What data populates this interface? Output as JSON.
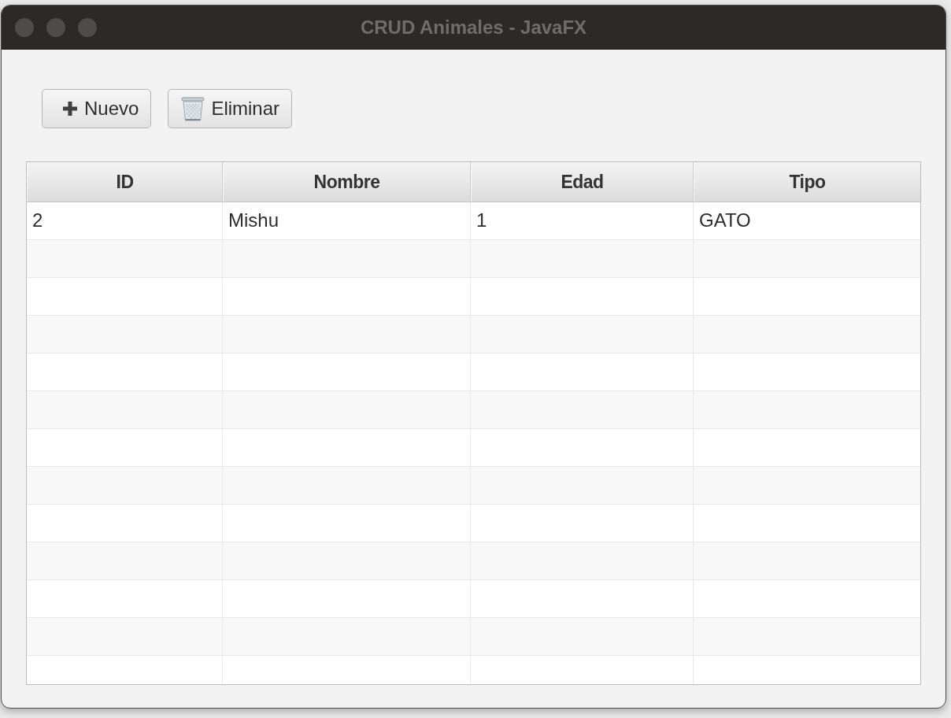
{
  "window": {
    "title": "CRUD Animales - JavaFX"
  },
  "toolbar": {
    "buttons": [
      {
        "label": "Nuevo",
        "kind": "add"
      },
      {
        "label": "Eliminar",
        "kind": "delete"
      }
    ]
  },
  "table": {
    "columns": [
      "ID",
      "Nombre",
      "Edad",
      "Tipo"
    ],
    "rows": [
      {
        "cells": [
          "2",
          "Mishu",
          "1",
          "GATO"
        ],
        "selected": false
      }
    ]
  }
}
